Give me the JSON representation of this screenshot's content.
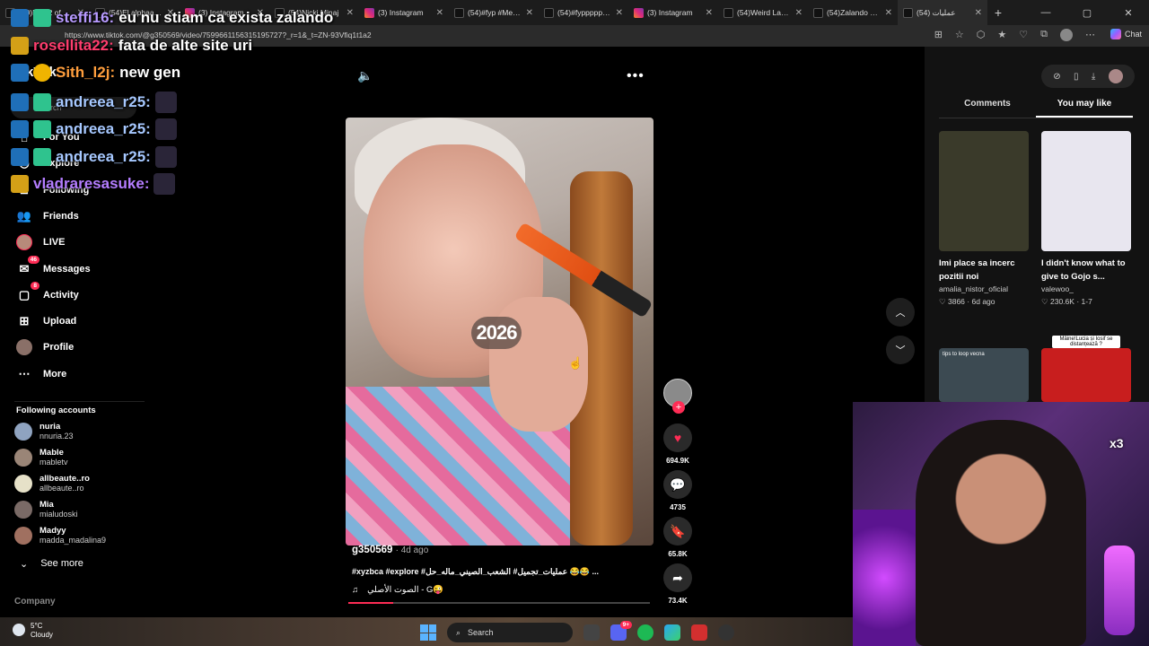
{
  "browser": {
    "tabs": [
      {
        "label": "(50)Day 2 of Tryi",
        "icon": "tiktok-icon",
        "kind": "tt"
      },
      {
        "label": "(54)El alphaaa @",
        "icon": "tiktok-icon",
        "kind": "tt"
      },
      {
        "label": "(3) Instagram",
        "icon": "instagram-icon",
        "kind": "ig"
      },
      {
        "label": "(54)Nicki Minaj",
        "icon": "tiktok-icon",
        "kind": "tt"
      },
      {
        "label": "(3) Instagram",
        "icon": "instagram-icon",
        "kind": "ig"
      },
      {
        "label": "(54)#fyp #Meme",
        "icon": "tiktok-icon",
        "kind": "tt"
      },
      {
        "label": "(54)#fypppppppp",
        "icon": "tiktok-icon",
        "kind": "tt"
      },
      {
        "label": "(3) Instagram",
        "icon": "instagram-icon",
        "kind": "ig"
      },
      {
        "label": "(54)Weird Laugh",
        "icon": "tiktok-icon",
        "kind": "tt"
      },
      {
        "label": "(54)Zalando a cu",
        "icon": "tiktok-icon",
        "kind": "tt"
      },
      {
        "label": "عمليات (54)",
        "icon": "tiktok-icon",
        "kind": "tt"
      }
    ],
    "url": "https://www.tiktok.com/@g350569/video/7599661156315195727?_r=1&_t=ZN-93Vfiq1t1a2",
    "chat_label": "Chat"
  },
  "sidebar": {
    "logo": "TikTok",
    "search_placeholder": "Search",
    "nav": [
      {
        "label": "For You",
        "icon": "home-icon"
      },
      {
        "label": "Explore",
        "icon": "compass-icon"
      },
      {
        "label": "Following",
        "icon": "following-icon"
      },
      {
        "label": "Friends",
        "icon": "friends-icon"
      },
      {
        "label": "LIVE",
        "icon": "live-icon"
      },
      {
        "label": "Messages",
        "icon": "messages-icon",
        "badge": "46"
      },
      {
        "label": "Activity",
        "icon": "activity-icon",
        "badge": "8"
      },
      {
        "label": "Upload",
        "icon": "upload-icon"
      },
      {
        "label": "Profile",
        "icon": "profile-icon"
      },
      {
        "label": "More",
        "icon": "more-icon"
      }
    ],
    "following_title": "Following accounts",
    "accounts": [
      {
        "name": "nuria",
        "handle": "nnuria.23",
        "color": "#8fa3c0"
      },
      {
        "name": "Mable",
        "handle": "mabletv",
        "color": "#9a8577"
      },
      {
        "name": "allbeaute..ro",
        "handle": "allbeaute..ro",
        "color": "#e6e1c8"
      },
      {
        "name": "Mia",
        "handle": "mialudoski",
        "color": "#7a6a66"
      },
      {
        "name": "Madyy",
        "handle": "madda_madalina9",
        "color": "#a07060"
      }
    ],
    "see_more": "See more",
    "company": "Company"
  },
  "stream_chat": [
    {
      "user": "steffi16:",
      "message": "eu nu stiam ca exista zalando",
      "cls": "u-steffi"
    },
    {
      "user": "rosellita22:",
      "message": "fata de alte site uri",
      "cls": "u-rose"
    },
    {
      "user": "Sith_l2j:",
      "message": "new gen",
      "cls": "u-sith"
    },
    {
      "user": "andreea_r25:",
      "message": "",
      "cls": "u-andreea"
    },
    {
      "user": "andreea_r25:",
      "message": "",
      "cls": "u-andreea"
    },
    {
      "user": "andreea_r25:",
      "message": "",
      "cls": "u-andreea"
    },
    {
      "user": "vladraresasuke:",
      "message": "",
      "cls": "u-vlad"
    }
  ],
  "video": {
    "watermark": "2026",
    "author": "g350569",
    "age": "4d ago",
    "description": "#xyzbca #explore #عمليات_تجميل# الشعب_الصيني_ماله_حل 😂😂 ...",
    "music": "الصوت الأصلي - G😜",
    "progress": 0.15,
    "likes": "694.9K",
    "comments": "4735",
    "saves": "65.8K",
    "shares": "73.4K"
  },
  "right_panel": {
    "tabs": [
      "Comments",
      "You may like"
    ],
    "active_tab": "You may like",
    "cards": [
      {
        "title": "Imi place sa incerc pozitii noi",
        "user": "amalia_nistor_oficial",
        "likes": "3866",
        "age": "6d ago",
        "thumb_color": "#3a3a2a"
      },
      {
        "title": "I didn't know what to give to Gojo s...",
        "user": "valewoo_",
        "likes": "230.6K",
        "age": "1-7",
        "thumb_color": "#e8e6ef"
      }
    ],
    "small_cards": [
      {
        "caption": "tips to loop vecna",
        "thumb_color": "#3c4a52"
      },
      {
        "caption": "Mâine!Lucia și Iosif se distanțează ?",
        "thumb_color": "#c81e1e"
      }
    ]
  },
  "webcam": {
    "overlay_text": "x3"
  },
  "taskbar": {
    "temp": "5°C",
    "condition": "Cloudy",
    "search_label": "Search",
    "discord_badge": "9+"
  }
}
